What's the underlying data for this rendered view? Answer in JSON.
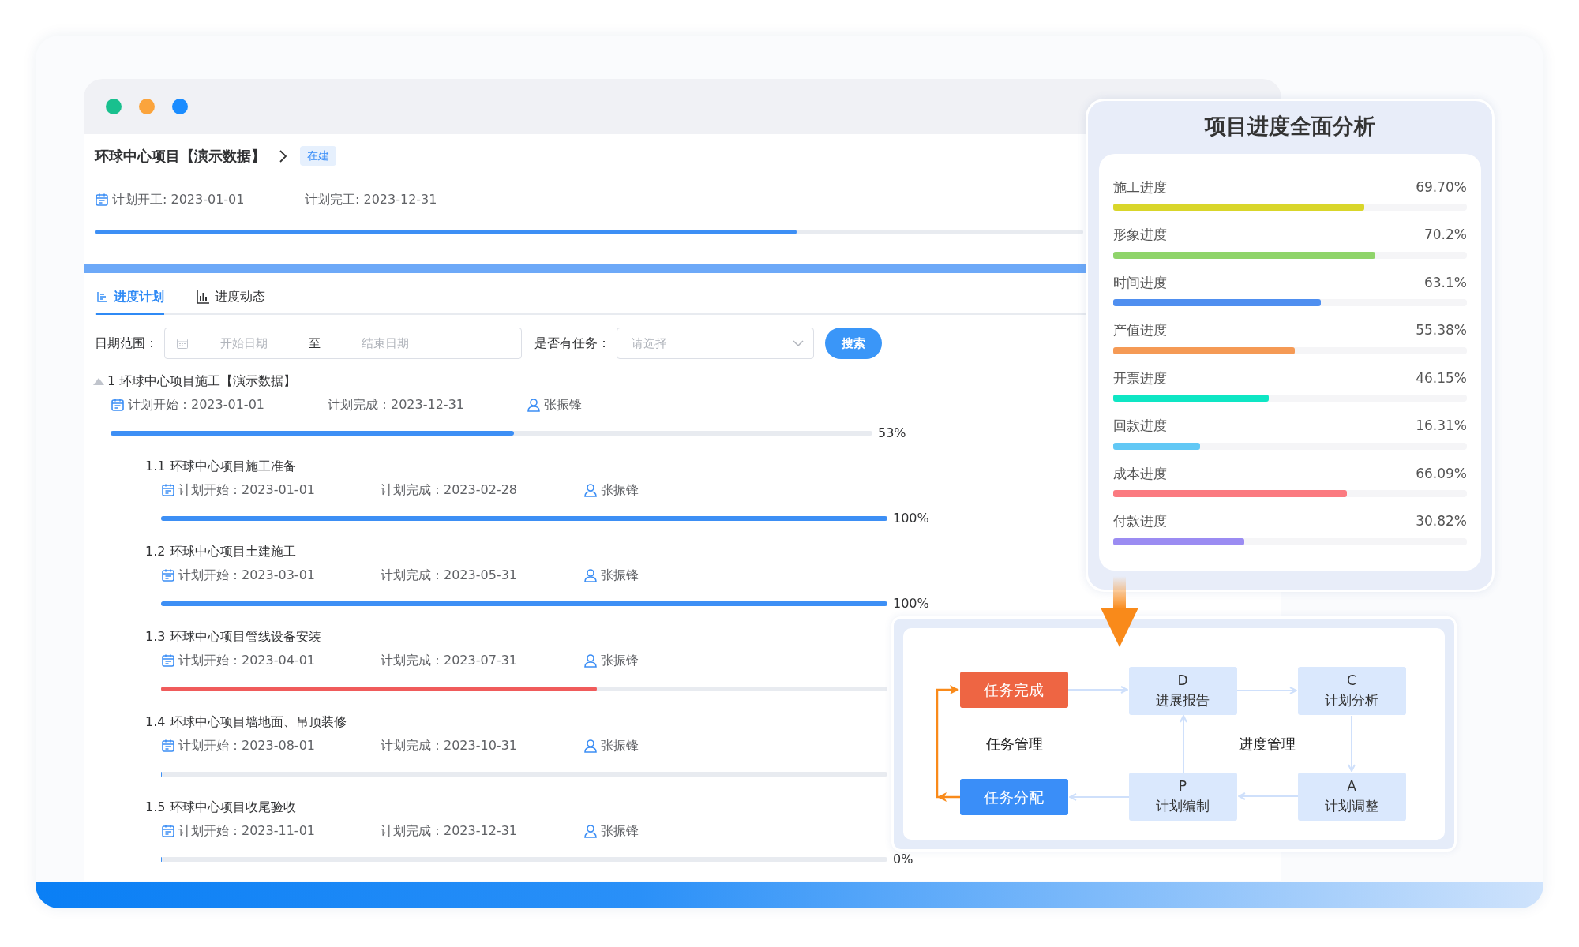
{
  "window": {
    "controls": [
      {
        "color": "#19c08e"
      },
      {
        "color": "#fba43c"
      },
      {
        "color": "#1a8cff"
      }
    ]
  },
  "project": {
    "name": "环球中心项目【演示数据】",
    "status": "在建",
    "planned_start": "计划开工: 2023-01-01",
    "planned_end": "计划完工: 2023-12-31",
    "progress": {
      "level": 0.71
    }
  },
  "tabs": [
    {
      "label": "进度计划",
      "selected": true,
      "kind": "outline"
    },
    {
      "label": "进度动态",
      "selected": false,
      "kind": "chart"
    }
  ],
  "filters": {
    "date_range": {
      "label": "日期范围：",
      "start_placeholder": "开始日期",
      "separator": "至",
      "end_placeholder": "结束日期"
    },
    "has_task": {
      "label": "是否有任务：",
      "placeholder": "请选择"
    },
    "search_button": "搜索"
  },
  "tasks": [
    {
      "title": "1 环球中心项目施工【演示数据】",
      "expanded": true,
      "start": "计划开始：2023-01-01",
      "end": "计划完成：2023-12-31",
      "owner": "张振锋",
      "level": 0.53,
      "color": "#3d8ff5",
      "percent": "53%",
      "children": [
        {
          "title": "1.1 环球中心项目施工准备",
          "start": "计划开始：2023-01-01",
          "end": "计划完成：2023-02-28",
          "owner": "张振锋",
          "level": 1,
          "color": "#3d8ff5",
          "percent": "100%"
        },
        {
          "title": "1.2 环球中心项目土建施工",
          "start": "计划开始：2023-03-01",
          "end": "计划完成：2023-05-31",
          "owner": "张振锋",
          "level": 1,
          "color": "#3d8ff5",
          "percent": "100%"
        },
        {
          "title": "1.3 环球中心项目管线设备安装",
          "start": "计划开始：2023-04-01",
          "end": "计划完成：2023-07-31",
          "owner": "张振锋",
          "level": 0.6,
          "color": "#f05b5b"
        },
        {
          "title": "1.4 环球中心项目墙地面、吊顶装修",
          "start": "计划开始：2023-08-01",
          "end": "计划完成：2023-10-31",
          "owner": "张振锋",
          "level": 0
        },
        {
          "title": "1.5 环球中心项目收尾验收",
          "start": "计划开始：2023-11-01",
          "end": "计划完成：2023-12-31",
          "owner": "张振锋",
          "level": 0,
          "percent": "0%"
        }
      ]
    }
  ],
  "analysis": {
    "title": "项目进度全面分析",
    "metrics": [
      {
        "label": "施工进度",
        "value": "69.70%",
        "level": 0.71,
        "color": "#d9d62a"
      },
      {
        "label": "形象进度",
        "value": "70.2%",
        "level": 0.74,
        "color": "#8fd46a"
      },
      {
        "label": "时间进度",
        "value": "63.1%",
        "level": 0.586,
        "color": "#4f8ff0"
      },
      {
        "label": "产值进度",
        "value": "55.38%",
        "level": 0.514,
        "color": "#f59a55"
      },
      {
        "label": "开票进度",
        "value": "46.15%",
        "level": 0.44,
        "color": "#0ee6c4"
      },
      {
        "label": "回款进度",
        "value": "16.31%",
        "level": 0.245,
        "color": "#62c8f5"
      },
      {
        "label": "成本进度",
        "value": "66.09%",
        "level": 0.66,
        "color": "#fb7a80"
      },
      {
        "label": "付款进度",
        "value": "30.82%",
        "level": 0.37,
        "color": "#9b8cf2"
      }
    ]
  },
  "flow": {
    "task_nodes": [
      {
        "label": "任务完成",
        "color": "#ee6543"
      },
      {
        "label": "任务分配",
        "color": "#3a8ef8"
      }
    ],
    "stage_nodes": [
      {
        "letter": "D",
        "label": "进展报告"
      },
      {
        "letter": "C",
        "label": "计划分析"
      },
      {
        "letter": "P",
        "label": "计划编制"
      },
      {
        "letter": "A",
        "label": "计划调整"
      }
    ],
    "group_labels": [
      "任务管理",
      "进度管理"
    ]
  }
}
